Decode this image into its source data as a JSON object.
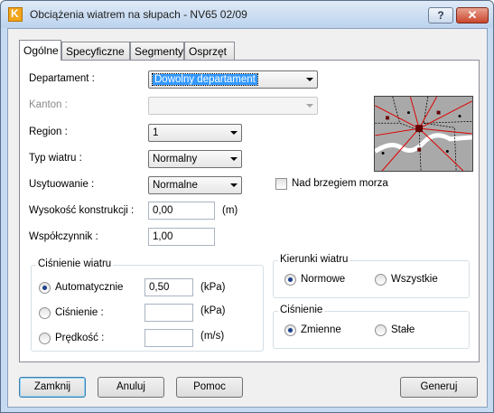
{
  "window": {
    "title": "Obciążenia wiatrem na słupach - NV65 02/09",
    "help_label": "?",
    "close_label": "✕"
  },
  "tabs": [
    "Ogólne",
    "Specyficzne",
    "Segmenty",
    "Osprzęt"
  ],
  "form": {
    "departament": {
      "label": "Departament :",
      "value": "Dowolny departament"
    },
    "kanton": {
      "label": "Kanton :",
      "value": ""
    },
    "region": {
      "label": "Region :",
      "value": "1"
    },
    "typ_wiatru": {
      "label": "Typ wiatru :",
      "value": "Normalny"
    },
    "usytuowanie": {
      "label": "Usytuowanie :",
      "value": "Normalne"
    },
    "nad_brzegiem": {
      "label": "Nad brzegiem morza",
      "checked": false
    },
    "wysokosc": {
      "label": "Wysokość konstrukcji :",
      "value": "0,00",
      "unit": "(m)"
    },
    "wspolczynnik": {
      "label": "Współczynnik :",
      "value": "1,00"
    }
  },
  "cisnienie_wiatru": {
    "title": "Ciśnienie wiatru",
    "options": [
      {
        "label": "Automatycznie",
        "value": "0,50",
        "unit": "(kPa)",
        "checked": true
      },
      {
        "label": "Ciśnienie :",
        "value": "",
        "unit": "(kPa)",
        "checked": false
      },
      {
        "label": "Prędkość :",
        "value": "",
        "unit": "(m/s)",
        "checked": false
      }
    ]
  },
  "kierunki_wiatru": {
    "title": "Kierunki wiatru",
    "options": [
      {
        "label": "Normowe",
        "checked": true
      },
      {
        "label": "Wszystkie",
        "checked": false
      }
    ]
  },
  "cisnienie": {
    "title": "Ciśnienie",
    "options": [
      {
        "label": "Zmienne",
        "checked": true
      },
      {
        "label": "Stałe",
        "checked": false
      }
    ]
  },
  "buttons": {
    "zamknij": "Zamknij",
    "anuluj": "Anuluj",
    "pomoc": "Pomoc",
    "generuj": "Generuj"
  },
  "icons": {
    "app": "app-icon",
    "map": "map-thumbnail"
  }
}
